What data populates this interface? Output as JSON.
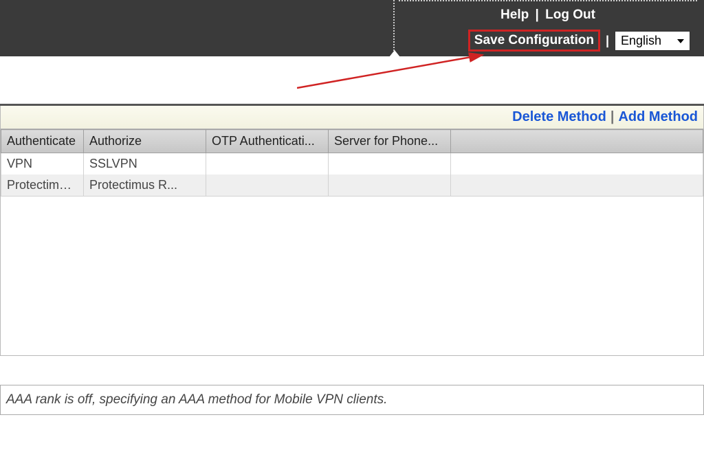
{
  "topbar": {
    "help": "Help",
    "logout": "Log Out",
    "save_config": "Save Configuration",
    "language": "English"
  },
  "actions": {
    "delete_method": "Delete Method",
    "add_method": "Add Method"
  },
  "table": {
    "headers": {
      "authenticate": "Authenticate",
      "authorize": "Authorize",
      "otp": "OTP Authenticati...",
      "phone": "Server for Phone..."
    },
    "rows": [
      {
        "authenticate": "VPN",
        "authorize": "SSLVPN",
        "otp": "",
        "phone": ""
      },
      {
        "authenticate": "Protectimus R...",
        "authorize": "Protectimus R...",
        "otp": "",
        "phone": ""
      }
    ]
  },
  "note": "AAA rank is off, specifying an AAA method for Mobile VPN clients."
}
